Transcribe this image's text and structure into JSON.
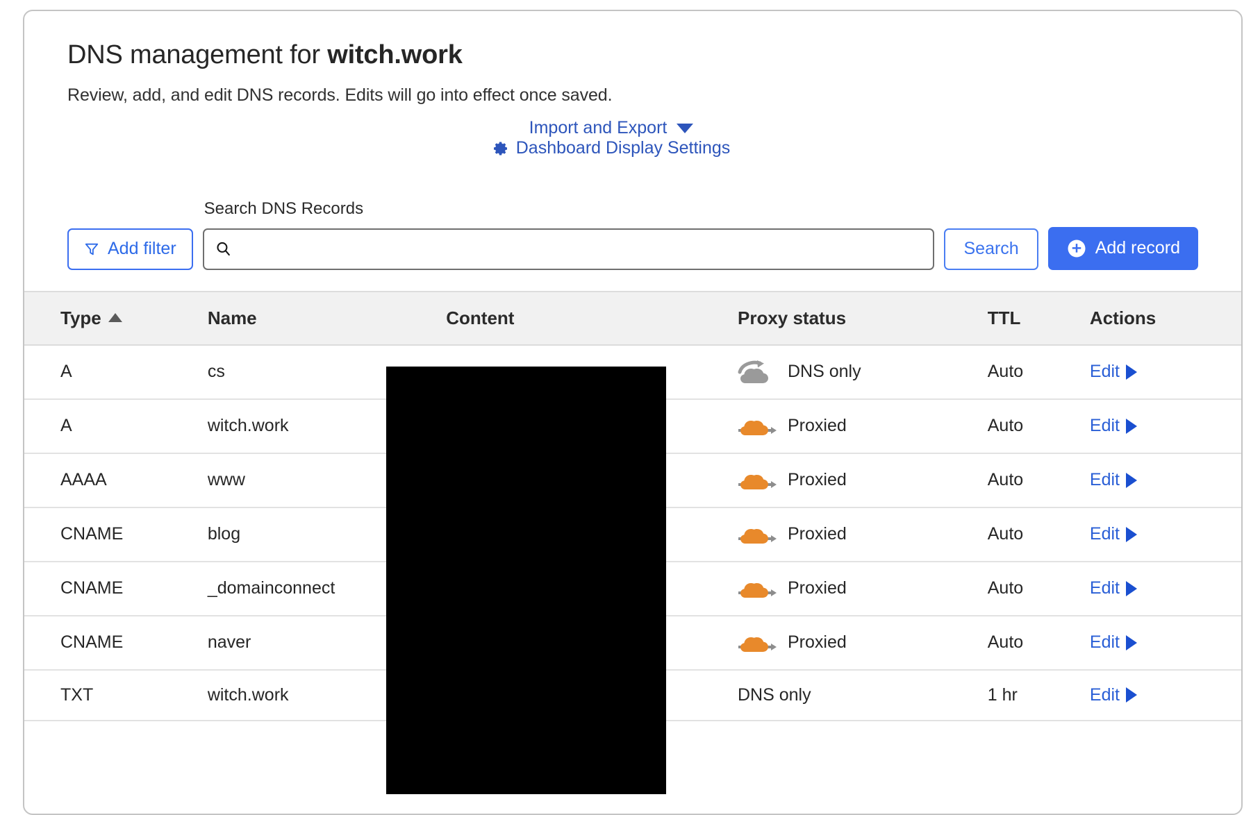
{
  "header": {
    "title_prefix": "DNS management for ",
    "title_domain": "witch.work",
    "subtitle": "Review, add, and edit DNS records. Edits will go into effect once saved.",
    "import_export_label": "Import and Export",
    "dashboard_settings_label": "Dashboard Display Settings",
    "caret_icon": "chevron-down-icon",
    "gear_icon": "gear-icon"
  },
  "toolbar": {
    "add_filter_label": "Add filter",
    "filter_icon": "funnel-icon",
    "search_label": "Search DNS Records",
    "search_value": "",
    "search_placeholder": "",
    "search_icon": "search-icon",
    "search_button_label": "Search",
    "add_record_label": "Add record",
    "add_record_icon": "plus-circle-icon"
  },
  "table": {
    "columns": [
      {
        "key": "type",
        "label": "Type",
        "sort": "asc"
      },
      {
        "key": "name",
        "label": "Name",
        "sort": null
      },
      {
        "key": "content",
        "label": "Content",
        "sort": null
      },
      {
        "key": "proxy",
        "label": "Proxy status",
        "sort": null
      },
      {
        "key": "ttl",
        "label": "TTL",
        "sort": null
      },
      {
        "key": "actions",
        "label": "Actions",
        "sort": null
      }
    ],
    "rows": [
      {
        "type": "A",
        "name": "cs",
        "content": "",
        "content_redacted": true,
        "proxy": "DNS only",
        "proxy_icon": "cloud-dns-only-icon",
        "ttl": "Auto",
        "action": "Edit"
      },
      {
        "type": "A",
        "name": "witch.work",
        "content": "",
        "content_redacted": true,
        "proxy": "Proxied",
        "proxy_icon": "cloud-proxied-icon",
        "ttl": "Auto",
        "action": "Edit"
      },
      {
        "type": "AAAA",
        "name": "www",
        "content": "",
        "content_redacted": true,
        "proxy": "Proxied",
        "proxy_icon": "cloud-proxied-icon",
        "ttl": "Auto",
        "action": "Edit"
      },
      {
        "type": "CNAME",
        "name": "blog",
        "content": "",
        "content_redacted": true,
        "proxy": "Proxied",
        "proxy_icon": "cloud-proxied-icon",
        "ttl": "Auto",
        "action": "Edit"
      },
      {
        "type": "CNAME",
        "name": "_domainconnect",
        "content": "",
        "content_redacted": true,
        "proxy": "Proxied",
        "proxy_icon": "cloud-proxied-icon",
        "ttl": "Auto",
        "action": "Edit"
      },
      {
        "type": "CNAME",
        "name": "naver",
        "content": "",
        "content_redacted": true,
        "proxy": "Proxied",
        "proxy_icon": "cloud-proxied-icon",
        "ttl": "Auto",
        "action": "Edit"
      },
      {
        "type": "TXT",
        "name": "witch.work",
        "content": "",
        "content_redacted": true,
        "proxy": "DNS only",
        "proxy_icon": null,
        "ttl": "1 hr",
        "action": "Edit"
      }
    ]
  },
  "colors": {
    "link_blue": "#2d55bb",
    "primary_blue": "#3b6ef0",
    "proxied_orange": "#e8892b",
    "dns_only_grey": "#9a9a9a",
    "header_band": "#f1f1f1",
    "redaction": "#000000"
  }
}
